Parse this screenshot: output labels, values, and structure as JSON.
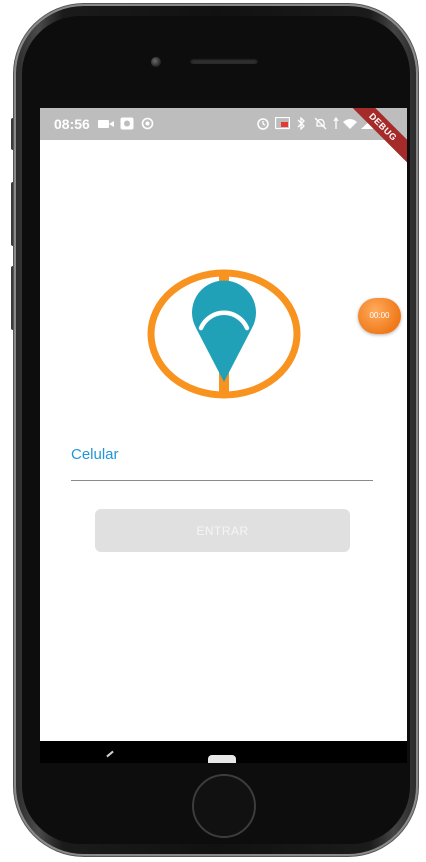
{
  "status_bar": {
    "time": "08:56",
    "debug_label": "DEBUG"
  },
  "login": {
    "phone_label": "Celular",
    "phone_value": "",
    "enter_button": "ENTRAR"
  },
  "overlay": {
    "timer": "00:00"
  },
  "colors": {
    "accent_blue": "#2196d6",
    "logo_orange": "#f7931e",
    "logo_teal": "#21a1b8",
    "button_disabled": "#e0e0e0",
    "timer_orange": "#f07a1a"
  }
}
